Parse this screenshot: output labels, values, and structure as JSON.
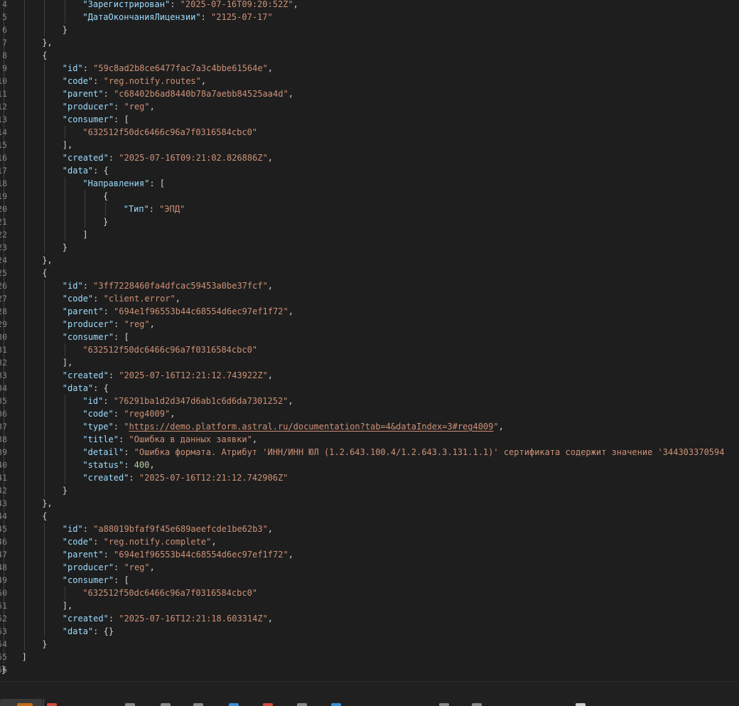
{
  "editor": {
    "language": "json",
    "lines": [
      {
        "no": "4",
        "indent": 4,
        "tokens": [
          {
            "t": "k",
            "v": "\"Зарегистрирован\""
          },
          {
            "t": "p",
            "v": ": "
          },
          {
            "t": "s",
            "v": "\"2025-07-16T09:20:52Z\""
          },
          {
            "t": "p",
            "v": ","
          }
        ]
      },
      {
        "no": "5",
        "indent": 4,
        "tokens": [
          {
            "t": "k",
            "v": "\"ДатаОкончанияЛицензии\""
          },
          {
            "t": "p",
            "v": ": "
          },
          {
            "t": "s",
            "v": "\"2125-07-17\""
          }
        ]
      },
      {
        "no": "6",
        "indent": 3,
        "tokens": [
          {
            "t": "p",
            "v": "}"
          }
        ]
      },
      {
        "no": "7",
        "indent": 2,
        "tokens": [
          {
            "t": "p",
            "v": "},"
          }
        ]
      },
      {
        "no": "8",
        "indent": 2,
        "tokens": [
          {
            "t": "p",
            "v": "{"
          }
        ]
      },
      {
        "no": "9",
        "indent": 3,
        "tokens": [
          {
            "t": "k",
            "v": "\"id\""
          },
          {
            "t": "p",
            "v": ": "
          },
          {
            "t": "s",
            "v": "\"59c8ad2b8ce6477fac7a3c4bbe61564e\""
          },
          {
            "t": "p",
            "v": ","
          }
        ]
      },
      {
        "no": "10",
        "indent": 3,
        "tokens": [
          {
            "t": "k",
            "v": "\"code\""
          },
          {
            "t": "p",
            "v": ": "
          },
          {
            "t": "s",
            "v": "\"reg.notify.routes\""
          },
          {
            "t": "p",
            "v": ","
          }
        ]
      },
      {
        "no": "11",
        "indent": 3,
        "tokens": [
          {
            "t": "k",
            "v": "\"parent\""
          },
          {
            "t": "p",
            "v": ": "
          },
          {
            "t": "s",
            "v": "\"c68402b6ad8440b78a7aebb84525aa4d\""
          },
          {
            "t": "p",
            "v": ","
          }
        ]
      },
      {
        "no": "12",
        "indent": 3,
        "tokens": [
          {
            "t": "k",
            "v": "\"producer\""
          },
          {
            "t": "p",
            "v": ": "
          },
          {
            "t": "s",
            "v": "\"reg\""
          },
          {
            "t": "p",
            "v": ","
          }
        ]
      },
      {
        "no": "13",
        "indent": 3,
        "tokens": [
          {
            "t": "k",
            "v": "\"consumer\""
          },
          {
            "t": "p",
            "v": ": ["
          }
        ]
      },
      {
        "no": "14",
        "indent": 4,
        "tokens": [
          {
            "t": "s",
            "v": "\"632512f50dc6466c96a7f0316584cbc0\""
          }
        ]
      },
      {
        "no": "15",
        "indent": 3,
        "tokens": [
          {
            "t": "p",
            "v": "],"
          }
        ]
      },
      {
        "no": "16",
        "indent": 3,
        "tokens": [
          {
            "t": "k",
            "v": "\"created\""
          },
          {
            "t": "p",
            "v": ": "
          },
          {
            "t": "s",
            "v": "\"2025-07-16T09:21:02.826886Z\""
          },
          {
            "t": "p",
            "v": ","
          }
        ]
      },
      {
        "no": "17",
        "indent": 3,
        "tokens": [
          {
            "t": "k",
            "v": "\"data\""
          },
          {
            "t": "p",
            "v": ": {"
          }
        ]
      },
      {
        "no": "18",
        "indent": 4,
        "tokens": [
          {
            "t": "k",
            "v": "\"Направления\""
          },
          {
            "t": "p",
            "v": ": ["
          }
        ]
      },
      {
        "no": "19",
        "indent": 5,
        "tokens": [
          {
            "t": "p",
            "v": "{"
          }
        ]
      },
      {
        "no": "20",
        "indent": 6,
        "tokens": [
          {
            "t": "k",
            "v": "\"Тип\""
          },
          {
            "t": "p",
            "v": ": "
          },
          {
            "t": "s",
            "v": "\"ЭПД\""
          }
        ]
      },
      {
        "no": "21",
        "indent": 5,
        "tokens": [
          {
            "t": "p",
            "v": "}"
          }
        ]
      },
      {
        "no": "22",
        "indent": 4,
        "tokens": [
          {
            "t": "p",
            "v": "]"
          }
        ]
      },
      {
        "no": "23",
        "indent": 3,
        "tokens": [
          {
            "t": "p",
            "v": "}"
          }
        ]
      },
      {
        "no": "24",
        "indent": 2,
        "tokens": [
          {
            "t": "p",
            "v": "},"
          }
        ]
      },
      {
        "no": "25",
        "indent": 2,
        "tokens": [
          {
            "t": "p",
            "v": "{"
          }
        ]
      },
      {
        "no": "26",
        "indent": 3,
        "tokens": [
          {
            "t": "k",
            "v": "\"id\""
          },
          {
            "t": "p",
            "v": ": "
          },
          {
            "t": "s",
            "v": "\"3ff7228460fa4dfcac59453a0be37fcf\""
          },
          {
            "t": "p",
            "v": ","
          }
        ]
      },
      {
        "no": "27",
        "indent": 3,
        "tokens": [
          {
            "t": "k",
            "v": "\"code\""
          },
          {
            "t": "p",
            "v": ": "
          },
          {
            "t": "s",
            "v": "\"client.error\""
          },
          {
            "t": "p",
            "v": ","
          }
        ]
      },
      {
        "no": "28",
        "indent": 3,
        "tokens": [
          {
            "t": "k",
            "v": "\"parent\""
          },
          {
            "t": "p",
            "v": ": "
          },
          {
            "t": "s",
            "v": "\"694e1f96553b44c68554d6ec97ef1f72\""
          },
          {
            "t": "p",
            "v": ","
          }
        ]
      },
      {
        "no": "29",
        "indent": 3,
        "tokens": [
          {
            "t": "k",
            "v": "\"producer\""
          },
          {
            "t": "p",
            "v": ": "
          },
          {
            "t": "s",
            "v": "\"reg\""
          },
          {
            "t": "p",
            "v": ","
          }
        ]
      },
      {
        "no": "30",
        "indent": 3,
        "tokens": [
          {
            "t": "k",
            "v": "\"consumer\""
          },
          {
            "t": "p",
            "v": ": ["
          }
        ]
      },
      {
        "no": "31",
        "indent": 4,
        "tokens": [
          {
            "t": "s",
            "v": "\"632512f50dc6466c96a7f0316584cbc0\""
          }
        ]
      },
      {
        "no": "32",
        "indent": 3,
        "tokens": [
          {
            "t": "p",
            "v": "],"
          }
        ]
      },
      {
        "no": "33",
        "indent": 3,
        "tokens": [
          {
            "t": "k",
            "v": "\"created\""
          },
          {
            "t": "p",
            "v": ": "
          },
          {
            "t": "s",
            "v": "\"2025-07-16T12:21:12.743922Z\""
          },
          {
            "t": "p",
            "v": ","
          }
        ]
      },
      {
        "no": "34",
        "indent": 3,
        "tokens": [
          {
            "t": "k",
            "v": "\"data\""
          },
          {
            "t": "p",
            "v": ": {"
          }
        ]
      },
      {
        "no": "35",
        "indent": 4,
        "tokens": [
          {
            "t": "k",
            "v": "\"id\""
          },
          {
            "t": "p",
            "v": ": "
          },
          {
            "t": "s",
            "v": "\"76291ba1d2d347d6ab1c6d6da7301252\""
          },
          {
            "t": "p",
            "v": ","
          }
        ]
      },
      {
        "no": "36",
        "indent": 4,
        "tokens": [
          {
            "t": "k",
            "v": "\"code\""
          },
          {
            "t": "p",
            "v": ": "
          },
          {
            "t": "s",
            "v": "\"reg4009\""
          },
          {
            "t": "p",
            "v": ","
          }
        ]
      },
      {
        "no": "37",
        "indent": 4,
        "tokens": [
          {
            "t": "k",
            "v": "\"type\""
          },
          {
            "t": "p",
            "v": ": "
          },
          {
            "t": "s",
            "v": "\""
          },
          {
            "t": "u",
            "v": "https://demo.platform.astral.ru/documentation?tab=4&dataIndex=3#reg4009"
          },
          {
            "t": "s",
            "v": "\""
          },
          {
            "t": "p",
            "v": ","
          }
        ]
      },
      {
        "no": "38",
        "indent": 4,
        "tokens": [
          {
            "t": "k",
            "v": "\"title\""
          },
          {
            "t": "p",
            "v": ": "
          },
          {
            "t": "s",
            "v": "\"Ошибка в данных заявки\""
          },
          {
            "t": "p",
            "v": ","
          }
        ]
      },
      {
        "no": "39",
        "indent": 4,
        "tokens": [
          {
            "t": "k",
            "v": "\"detail\""
          },
          {
            "t": "p",
            "v": ": "
          },
          {
            "t": "s",
            "v": "\"Ошибка формата. Атрибут 'ИНН/ИНН ЮЛ (1.2.643.100.4/1.2.643.3.131.1.1)' сертификата содержит значение '344303370594"
          }
        ]
      },
      {
        "no": "40",
        "indent": 4,
        "tokens": [
          {
            "t": "k",
            "v": "\"status\""
          },
          {
            "t": "p",
            "v": ": "
          },
          {
            "t": "n",
            "v": "400"
          },
          {
            "t": "p",
            "v": ","
          }
        ]
      },
      {
        "no": "41",
        "indent": 4,
        "tokens": [
          {
            "t": "k",
            "v": "\"created\""
          },
          {
            "t": "p",
            "v": ": "
          },
          {
            "t": "s",
            "v": "\"2025-07-16T12:21:12.742906Z\""
          }
        ]
      },
      {
        "no": "42",
        "indent": 3,
        "tokens": [
          {
            "t": "p",
            "v": "}"
          }
        ]
      },
      {
        "no": "43",
        "indent": 2,
        "tokens": [
          {
            "t": "p",
            "v": "},"
          }
        ]
      },
      {
        "no": "44",
        "indent": 2,
        "tokens": [
          {
            "t": "p",
            "v": "{"
          }
        ]
      },
      {
        "no": "45",
        "indent": 3,
        "tokens": [
          {
            "t": "k",
            "v": "\"id\""
          },
          {
            "t": "p",
            "v": ": "
          },
          {
            "t": "s",
            "v": "\"a88019bfaf9f45e689aeefcde1be62b3\""
          },
          {
            "t": "p",
            "v": ","
          }
        ]
      },
      {
        "no": "46",
        "indent": 3,
        "tokens": [
          {
            "t": "k",
            "v": "\"code\""
          },
          {
            "t": "p",
            "v": ": "
          },
          {
            "t": "s",
            "v": "\"reg.notify.complete\""
          },
          {
            "t": "p",
            "v": ","
          }
        ]
      },
      {
        "no": "47",
        "indent": 3,
        "tokens": [
          {
            "t": "k",
            "v": "\"parent\""
          },
          {
            "t": "p",
            "v": ": "
          },
          {
            "t": "s",
            "v": "\"694e1f96553b44c68554d6ec97ef1f72\""
          },
          {
            "t": "p",
            "v": ","
          }
        ]
      },
      {
        "no": "48",
        "indent": 3,
        "tokens": [
          {
            "t": "k",
            "v": "\"producer\""
          },
          {
            "t": "p",
            "v": ": "
          },
          {
            "t": "s",
            "v": "\"reg\""
          },
          {
            "t": "p",
            "v": ","
          }
        ]
      },
      {
        "no": "49",
        "indent": 3,
        "tokens": [
          {
            "t": "k",
            "v": "\"consumer\""
          },
          {
            "t": "p",
            "v": ": ["
          }
        ]
      },
      {
        "no": "50",
        "indent": 4,
        "tokens": [
          {
            "t": "s",
            "v": "\"632512f50dc6466c96a7f0316584cbc0\""
          }
        ]
      },
      {
        "no": "51",
        "indent": 3,
        "tokens": [
          {
            "t": "p",
            "v": "],"
          }
        ]
      },
      {
        "no": "52",
        "indent": 3,
        "tokens": [
          {
            "t": "k",
            "v": "\"created\""
          },
          {
            "t": "p",
            "v": ": "
          },
          {
            "t": "s",
            "v": "\"2025-07-16T12:21:18.603314Z\""
          },
          {
            "t": "p",
            "v": ","
          }
        ]
      },
      {
        "no": "53",
        "indent": 3,
        "tokens": [
          {
            "t": "k",
            "v": "\"data\""
          },
          {
            "t": "p",
            "v": ": {}"
          }
        ]
      },
      {
        "no": "54",
        "indent": 2,
        "tokens": [
          {
            "t": "p",
            "v": "}"
          }
        ]
      },
      {
        "no": "55",
        "indent": 1,
        "tokens": [
          {
            "t": "p",
            "v": "]"
          }
        ]
      },
      {
        "no": "56",
        "indent": 0,
        "tokens": [
          {
            "t": "p",
            "v": "}"
          }
        ]
      }
    ]
  },
  "colors": {
    "background": "#1e1e1e",
    "key": "#9cdcfe",
    "string": "#ce9178",
    "number": "#b5cea8",
    "punctuation": "#d4d4d4",
    "line_number": "#858585",
    "taskbar": "#202020"
  },
  "taskbar": {
    "items": [
      {
        "icon": "active-app-icon",
        "color": "#c46a1a"
      },
      {
        "icon": "app-icon",
        "color": "#d04a3a"
      },
      {
        "icon": "app-icon",
        "color": "#888888"
      },
      {
        "icon": "app-icon",
        "color": "#888888"
      },
      {
        "icon": "app-icon",
        "color": "#888888"
      },
      {
        "icon": "app-icon",
        "color": "#3a8fd6"
      },
      {
        "icon": "app-icon",
        "color": "#d04a3a"
      },
      {
        "icon": "app-icon",
        "color": "#888888"
      },
      {
        "icon": "app-icon",
        "color": "#3a8fd6"
      },
      {
        "icon": "app-icon",
        "color": "#888888"
      },
      {
        "icon": "app-icon",
        "color": "#888888"
      },
      {
        "icon": "app-icon",
        "color": "#cccccc"
      }
    ]
  }
}
